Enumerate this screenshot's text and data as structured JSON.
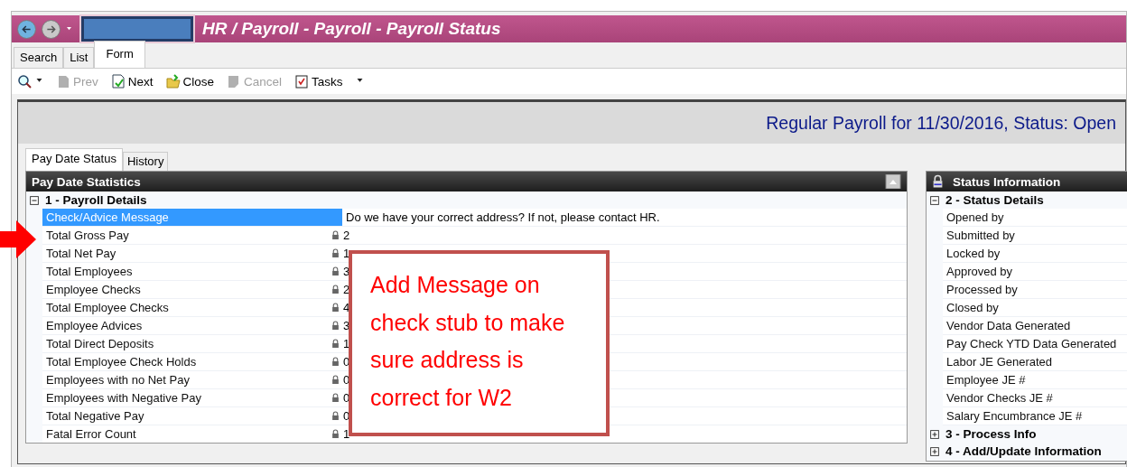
{
  "window": {
    "title": "HR / Payroll - Payroll - Payroll Status"
  },
  "nav_tabs": [
    {
      "label": "Search",
      "selected": false
    },
    {
      "label": "List",
      "selected": false
    },
    {
      "label": "Form",
      "selected": true
    }
  ],
  "toolbar": [
    {
      "kind": "prev",
      "label": "Prev",
      "disabled": true
    },
    {
      "kind": "next",
      "label": "Next",
      "disabled": false
    },
    {
      "kind": "close",
      "label": "Close",
      "disabled": false
    },
    {
      "kind": "cancel",
      "label": "Cancel",
      "disabled": true
    },
    {
      "kind": "tasks",
      "label": "Tasks",
      "disabled": false
    }
  ],
  "form_header": "Regular Payroll for 11/30/2016, Status: Open",
  "form_tabs": [
    {
      "label": "Pay Date Status",
      "selected": true
    },
    {
      "label": "History",
      "selected": false
    }
  ],
  "left_panel": {
    "title": "Pay Date Statistics",
    "sections": [
      {
        "title": "1 - Payroll Details",
        "expanded": true,
        "rows": [
          {
            "label": "Check/Advice Message",
            "value": "Do we have your correct address?  If not, please contact HR.",
            "locked": false,
            "selected": true
          },
          {
            "label": "Total Gross Pay",
            "value": "2",
            "locked": true,
            "selected": false
          },
          {
            "label": "Total Net Pay",
            "value": "1",
            "locked": true,
            "selected": false
          },
          {
            "label": "Total Employees",
            "value": "3",
            "locked": true,
            "selected": false
          },
          {
            "label": "Employee Checks",
            "value": "2",
            "locked": true,
            "selected": false
          },
          {
            "label": "Total Employee Checks",
            "value": "4",
            "locked": true,
            "selected": false
          },
          {
            "label": "Employee Advices",
            "value": "3",
            "locked": true,
            "selected": false
          },
          {
            "label": "Total Direct Deposits",
            "value": "1",
            "locked": true,
            "selected": false
          },
          {
            "label": "Total Employee Check Holds",
            "value": "0",
            "locked": true,
            "selected": false
          },
          {
            "label": "Employees with no Net Pay",
            "value": "0",
            "locked": true,
            "selected": false
          },
          {
            "label": "Employees with Negative Pay",
            "value": "0",
            "locked": true,
            "selected": false
          },
          {
            "label": "Total Negative Pay",
            "value": "0",
            "locked": true,
            "selected": false
          },
          {
            "label": "Fatal Error Count",
            "value": "1",
            "locked": true,
            "selected": false
          }
        ]
      }
    ]
  },
  "right_panel": {
    "title": "Status Information",
    "sections": [
      {
        "title": "2 - Status Details",
        "expanded": true,
        "rows": [
          {
            "label": "Opened by"
          },
          {
            "label": "Submitted by"
          },
          {
            "label": "Locked by"
          },
          {
            "label": "Approved by"
          },
          {
            "label": "Processed by"
          },
          {
            "label": "Closed by"
          },
          {
            "label": "Vendor Data Generated"
          },
          {
            "label": "Pay Check YTD Data Generated"
          },
          {
            "label": "Labor JE Generated"
          },
          {
            "label": "Employee JE #"
          },
          {
            "label": "Vendor Checks JE #"
          },
          {
            "label": "Salary Encumbrance JE #"
          }
        ]
      },
      {
        "title": "3 - Process Info",
        "expanded": false
      },
      {
        "title": "4 - Add/Update Information",
        "expanded": false
      }
    ]
  },
  "callout": {
    "text": "Add Message on check stub to make sure address is correct for W2"
  }
}
